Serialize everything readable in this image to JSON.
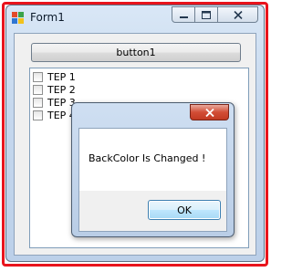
{
  "window": {
    "title": "Form1",
    "controls": {
      "minimize": "minimize-icon",
      "maximize": "maximize-icon",
      "close": "close-icon"
    }
  },
  "main": {
    "button_label": "button1",
    "checklist": [
      {
        "label": "TEP 1",
        "checked": false
      },
      {
        "label": "TEP 2",
        "checked": false
      },
      {
        "label": "TEP 3",
        "checked": false
      },
      {
        "label": "TEP 4",
        "checked": false
      }
    ]
  },
  "dialog": {
    "message": "BackColor Is Changed !",
    "ok_label": "OK",
    "close_icon": "close-icon"
  },
  "colors": {
    "highlight_border": "#e8141c",
    "dialog_close": "#c9452d",
    "ok_border": "#3c7fb1"
  }
}
